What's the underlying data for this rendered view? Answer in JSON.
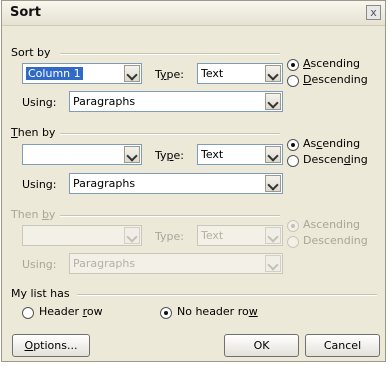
{
  "dialog": {
    "title": "Sort",
    "close_glyph": "x"
  },
  "sort_by": {
    "group_label": "Sort by",
    "column": "Column 1",
    "type_label": "Type:",
    "type_value": "Text",
    "using_label": "Using:",
    "using_value": "Paragraphs",
    "ascending": "Ascending",
    "descending": "Descending",
    "order": "ascending"
  },
  "then_by_1": {
    "group_label": "Then by",
    "column": "",
    "type_label": "Type:",
    "type_value": "Text",
    "using_label": "Using:",
    "using_value": "Paragraphs",
    "ascending": "Ascending",
    "descending": "Descending",
    "order": "ascending"
  },
  "then_by_2": {
    "group_label": "Then by",
    "column": "",
    "type_label": "Type:",
    "type_value": "Text",
    "using_label": "Using:",
    "using_value": "Paragraphs",
    "ascending": "Ascending",
    "descending": "Descending",
    "order": "ascending",
    "disabled": true
  },
  "header": {
    "group_label": "My list has",
    "header_row": "Header row",
    "no_header_row": "No header row",
    "selected": "no_header_row"
  },
  "buttons": {
    "options": "Options...",
    "ok": "OK",
    "cancel": "Cancel"
  }
}
